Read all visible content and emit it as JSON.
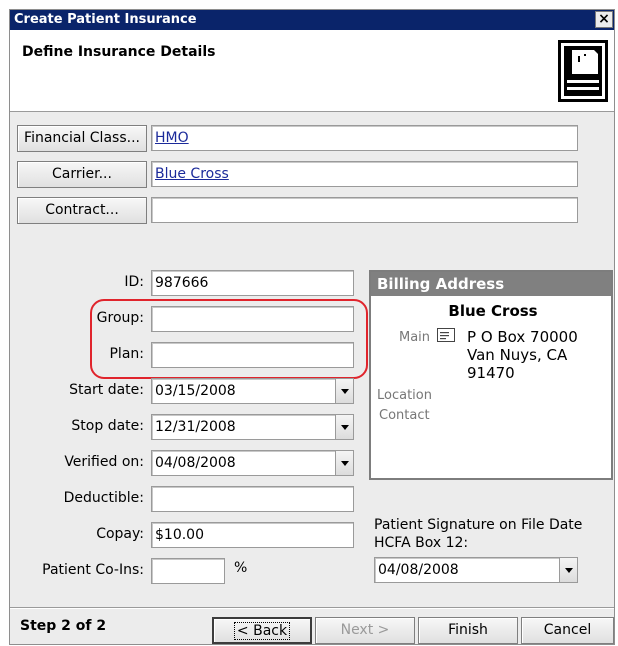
{
  "window": {
    "title": "Create Patient Insurance",
    "close_symbol": "×"
  },
  "header": {
    "title": "Define Insurance Details"
  },
  "lookups": [
    {
      "button": "Financial Class...",
      "value": "HMO"
    },
    {
      "button": "Carrier...",
      "value": "Blue Cross"
    },
    {
      "button": "Contract...",
      "value": ""
    }
  ],
  "form": {
    "id": {
      "label": "ID:",
      "value": "987666"
    },
    "group": {
      "label": "Group:",
      "value": ""
    },
    "plan": {
      "label": "Plan:",
      "value": ""
    },
    "start_date": {
      "label": "Start date:",
      "value": "03/15/2008"
    },
    "stop_date": {
      "label": "Stop date:",
      "value": "12/31/2008"
    },
    "verified_on": {
      "label": "Verified on:",
      "value": "04/08/2008"
    },
    "deductible": {
      "label": "Deductible:",
      "value": ""
    },
    "copay": {
      "label": "Copay:",
      "value": "$10.00"
    },
    "co_ins": {
      "label": "Patient Co-Ins:",
      "value": "",
      "suffix": "%"
    }
  },
  "billing": {
    "title": "Billing Address",
    "name": "Blue Cross",
    "main_label": "Main",
    "address_lines": [
      "P O Box 70000",
      "Van Nuys, CA",
      "91470"
    ],
    "location_label": "Location",
    "contact_label": "Contact"
  },
  "signature": {
    "label_line1": "Patient Signature on File Date",
    "label_line2": "HCFA Box 12:",
    "value": "04/08/2008"
  },
  "footer": {
    "step": "Step 2 of 2",
    "back": "< Back",
    "next": "Next >",
    "finish": "Finish",
    "cancel": "Cancel"
  },
  "colors": {
    "title_bar": "#0a246a",
    "highlight": "#e0242c",
    "billing_header": "#808080"
  }
}
